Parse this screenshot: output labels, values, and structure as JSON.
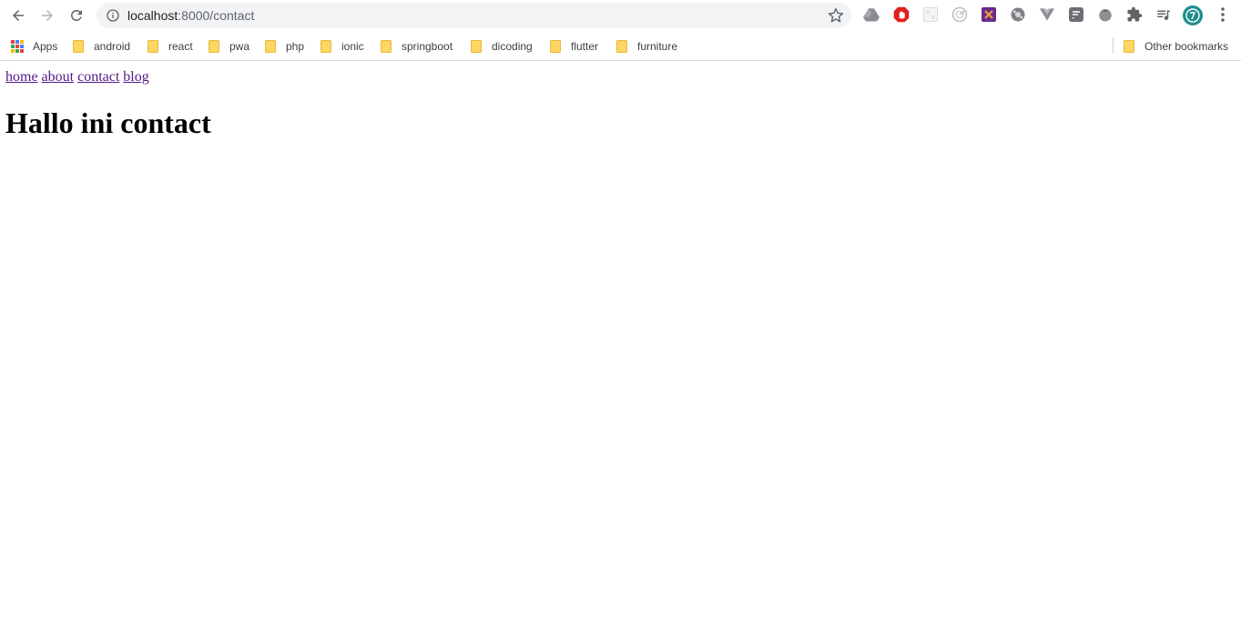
{
  "browser": {
    "url_host": "localhost",
    "url_rest": ":8000/contact",
    "extensions": [
      "google-drive-icon",
      "adblock-icon",
      "blank-extension-icon",
      "radar-extension-icon",
      "crossed-extension-icon",
      "gear-extension-icon",
      "vue-devtools-icon",
      "chat-extension-icon",
      "tomato-timer-icon",
      "puzzle-icon",
      "media-queue-icon"
    ],
    "profile_initial": "D",
    "colors": {
      "omnibox_bg": "#f1f3f4",
      "folder_yellow": "#fdd663",
      "link_visited": "#551a8b",
      "profile_bg": "#1e8e8e"
    }
  },
  "bookmarks": {
    "apps_label": "Apps",
    "items": [
      {
        "label": "android"
      },
      {
        "label": "react"
      },
      {
        "label": "pwa"
      },
      {
        "label": "php"
      },
      {
        "label": "ionic"
      },
      {
        "label": "springboot"
      },
      {
        "label": "dicoding"
      },
      {
        "label": "flutter"
      },
      {
        "label": "furniture"
      }
    ],
    "other_label": "Other bookmarks"
  },
  "page": {
    "nav": [
      {
        "label": "home"
      },
      {
        "label": "about"
      },
      {
        "label": "contact"
      },
      {
        "label": "blog"
      }
    ],
    "heading": "Hallo ini contact"
  }
}
